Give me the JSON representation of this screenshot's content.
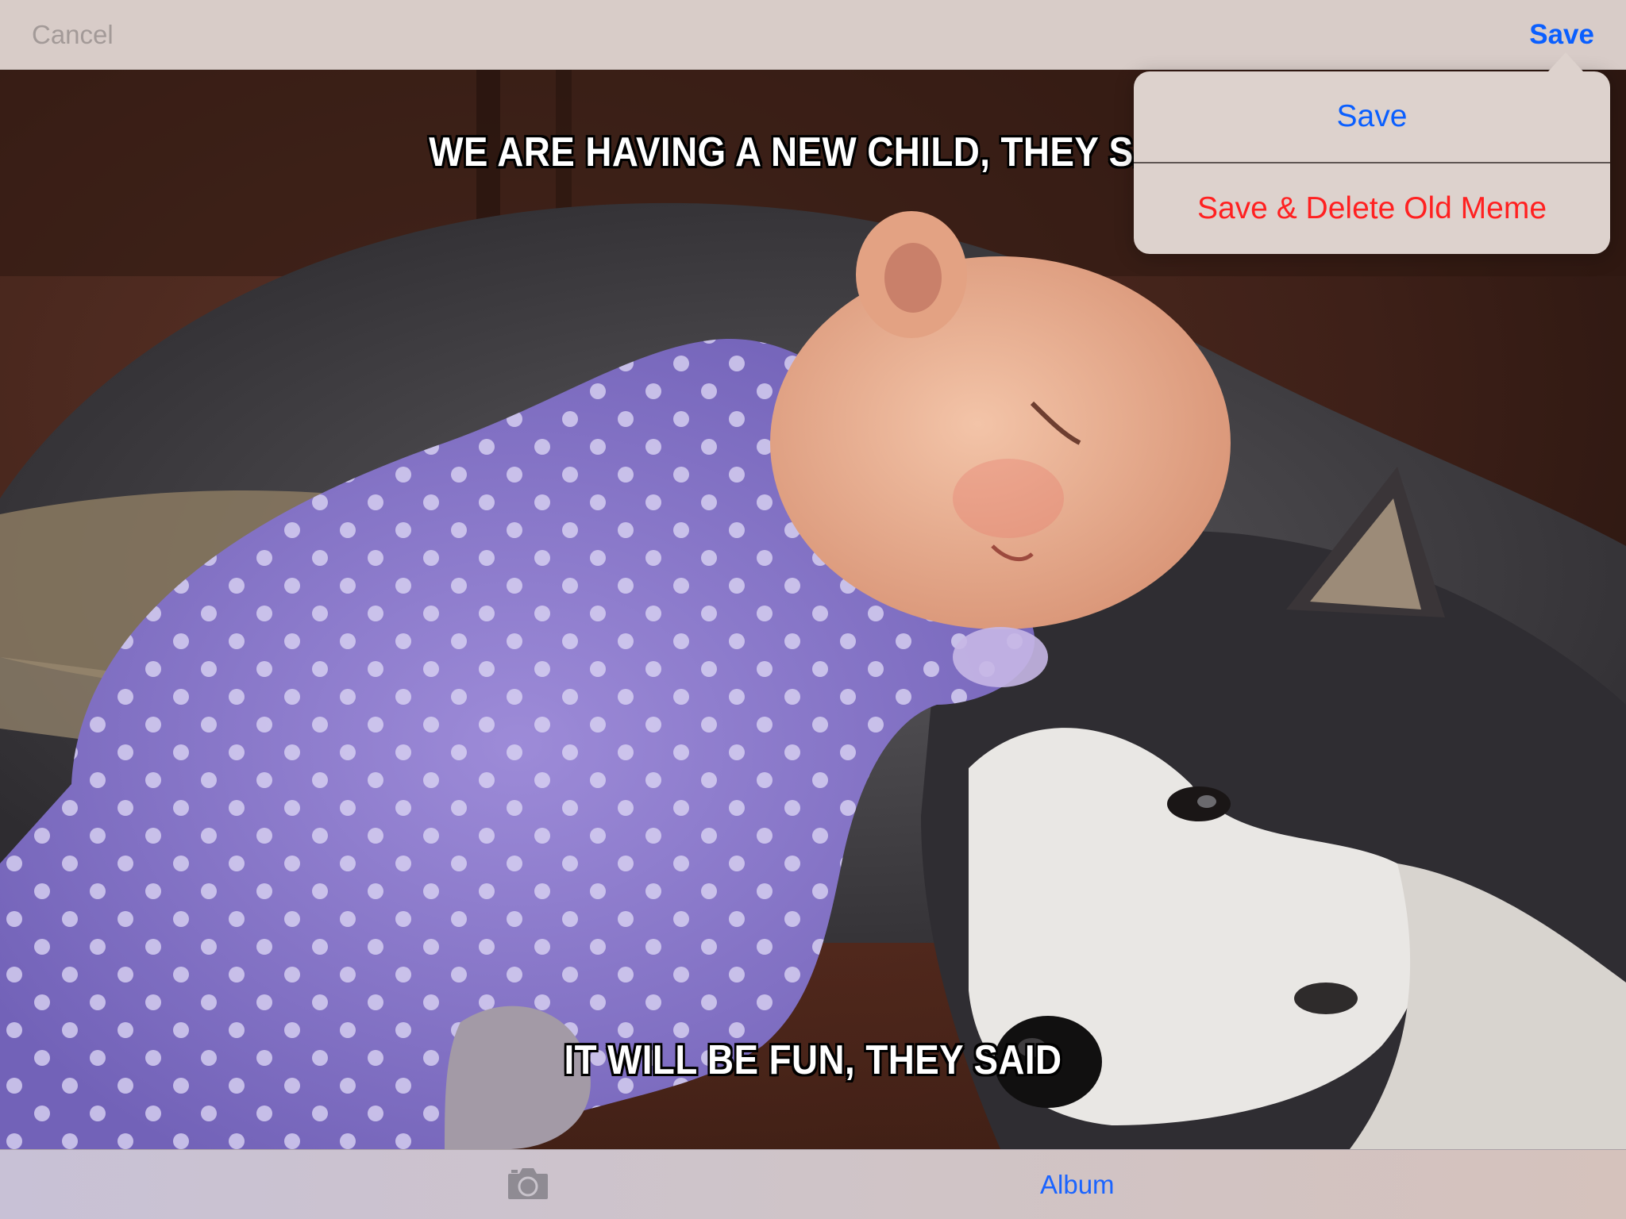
{
  "navbar": {
    "cancel_label": "Cancel",
    "save_label": "Save"
  },
  "meme": {
    "top_text": "WE ARE HAVING A NEW CHILD, THEY SAID",
    "bottom_text": "IT WILL BE FUN, THEY SAID"
  },
  "save_menu": {
    "items": [
      {
        "label": "Save",
        "color": "#0a5fff"
      },
      {
        "label": "Save & Delete Old Meme",
        "color": "#ff2121"
      }
    ]
  },
  "toolbar": {
    "camera_icon": "camera-icon",
    "album_label": "Album"
  },
  "colors": {
    "accent": "#0a5fff",
    "destructive": "#ff2121"
  }
}
